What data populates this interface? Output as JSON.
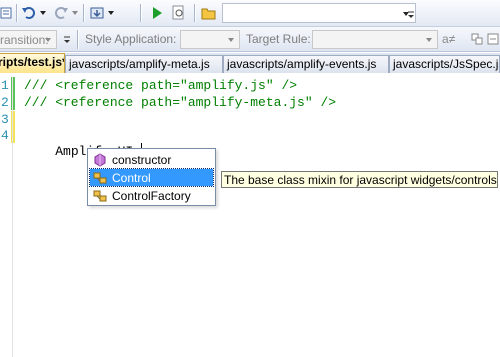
{
  "toolbar": {
    "icons": [
      "comment-icon",
      "undo-icon",
      "redo-icon",
      "publish-icon",
      "start-debugging-icon",
      "find-in-files-icon",
      "open-file-icon"
    ],
    "search_combo_value": ""
  },
  "style_toolbar": {
    "transition_value": "ransition:",
    "style_application_label": "Style Application:",
    "style_application_value": "",
    "target_rule_label": "Target Rule:",
    "target_rule_value": "",
    "font_glyph": "a≠"
  },
  "tabs": [
    {
      "label": "ripts/test.js*",
      "active": true
    },
    {
      "label": "javascripts/amplify-meta.js",
      "active": false
    },
    {
      "label": "javascripts/amplify-events.js",
      "active": false
    },
    {
      "label": "javascripts/JsSpec.js",
      "active": false
    }
  ],
  "editor": {
    "lines": [
      {
        "number": "1",
        "text": "/// <reference path=\"amplify.js\" />",
        "type": "comment"
      },
      {
        "number": "2",
        "text": "/// <reference path=\"amplify-meta.js\" />",
        "type": "comment"
      },
      {
        "number": "3",
        "text": "",
        "type": "blank"
      },
      {
        "number": "4",
        "text": "Amplify.UI.",
        "type": "code"
      }
    ]
  },
  "completion": {
    "items": [
      {
        "label": "constructor",
        "icon": "method-icon",
        "selected": false
      },
      {
        "label": "Control",
        "icon": "class-icon",
        "selected": true
      },
      {
        "label": "ControlFactory",
        "icon": "class-icon",
        "selected": false
      }
    ],
    "tooltip": "The base class mixin for javascript widgets/controls."
  },
  "colors": {
    "comment": "#008000",
    "line_number": "#2b91af",
    "selection": "#3399ff",
    "tooltip_bg": "#ffffe1",
    "active_tab": "#fde48a"
  }
}
